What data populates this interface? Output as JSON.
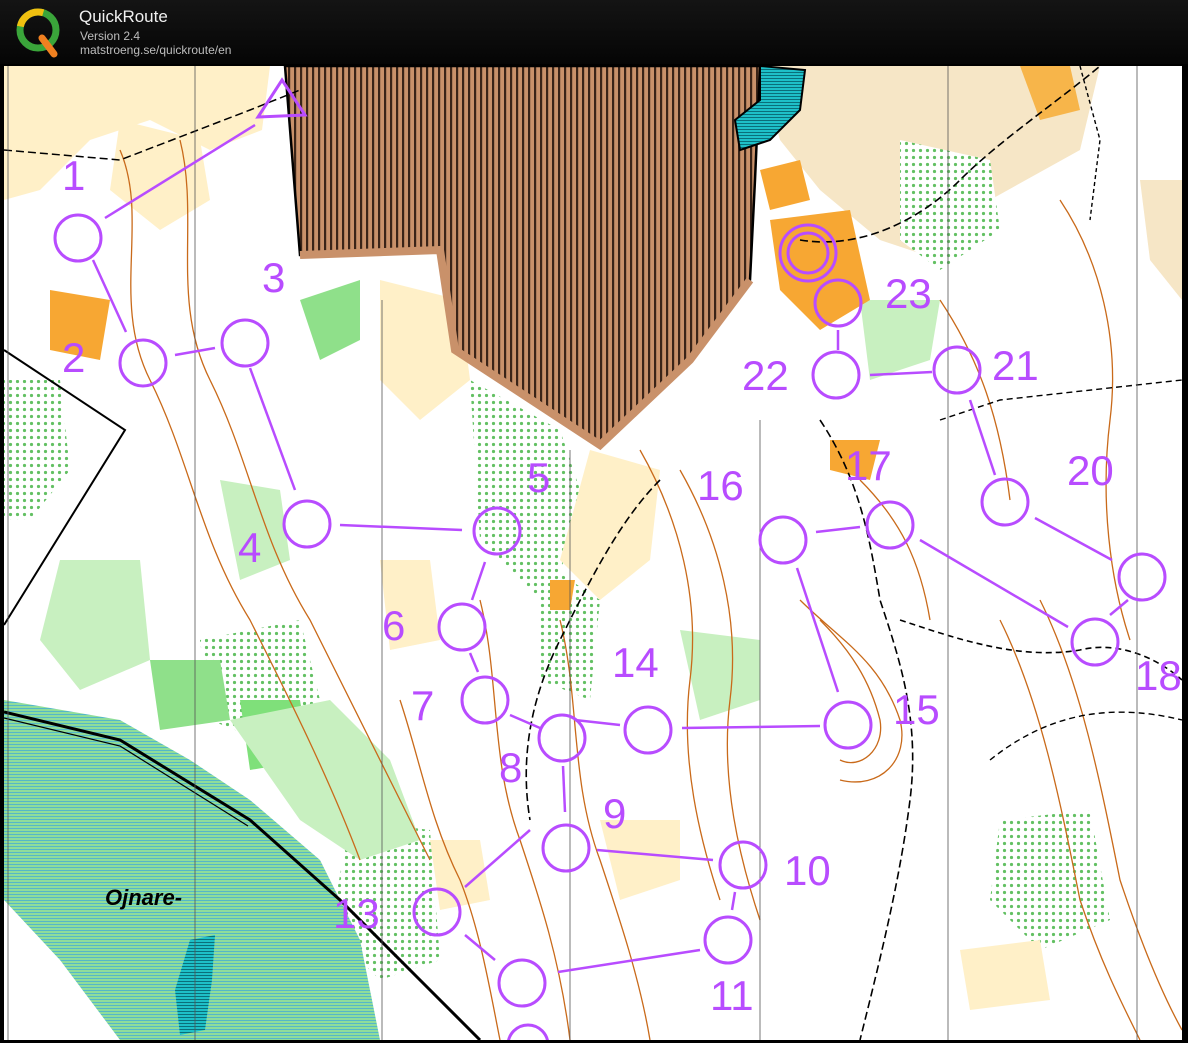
{
  "app": {
    "title": "QuickRoute",
    "version": "Version 2.4",
    "url": "matstroeng.se/quickroute/en"
  },
  "map": {
    "place_label": "Ojnare-",
    "course_color": "#b84cff",
    "controls": [
      {
        "id": "1",
        "label": "1"
      },
      {
        "id": "2",
        "label": "2"
      },
      {
        "id": "3",
        "label": "3"
      },
      {
        "id": "4",
        "label": "4"
      },
      {
        "id": "5",
        "label": "5"
      },
      {
        "id": "6",
        "label": "6"
      },
      {
        "id": "7",
        "label": "7"
      },
      {
        "id": "8",
        "label": "8"
      },
      {
        "id": "9",
        "label": "9"
      },
      {
        "id": "10",
        "label": "10"
      },
      {
        "id": "11",
        "label": "11"
      },
      {
        "id": "13",
        "label": "13"
      },
      {
        "id": "14",
        "label": "14"
      },
      {
        "id": "15",
        "label": "15"
      },
      {
        "id": "16",
        "label": "16"
      },
      {
        "id": "17",
        "label": "17"
      },
      {
        "id": "18",
        "label": "18"
      },
      {
        "id": "20",
        "label": "20"
      },
      {
        "id": "21",
        "label": "21"
      },
      {
        "id": "22",
        "label": "22"
      },
      {
        "id": "23",
        "label": "23"
      }
    ]
  }
}
